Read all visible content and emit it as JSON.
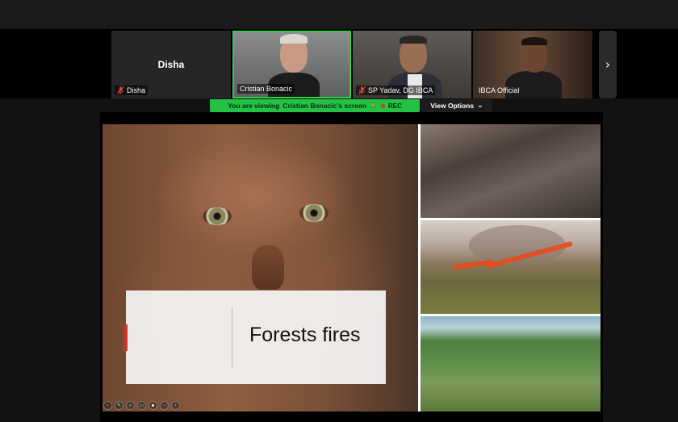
{
  "participants": {
    "disha": {
      "big_name": "Disha",
      "label": "Disha"
    },
    "cristian": {
      "label": "Cristian Bonacic"
    },
    "sp": {
      "label": "SP Yadav, DG IBCA"
    },
    "ibca": {
      "label": "IBCA Official"
    }
  },
  "share_banner": {
    "prefix": "You are viewing",
    "name": "Cristian Bonacic's screen",
    "rec_label": "REC"
  },
  "view_options": {
    "label": "View Options",
    "chevron": "⌄"
  },
  "next_arrow": "›",
  "slide": {
    "title": "Forests fires"
  },
  "icons": [
    "mic-muted-icon",
    "chevron-right-icon",
    "record-dot-icon"
  ],
  "colors": {
    "active_speaker": "#2ed24a",
    "banner": "#23c244",
    "accent": "#c0392b"
  }
}
